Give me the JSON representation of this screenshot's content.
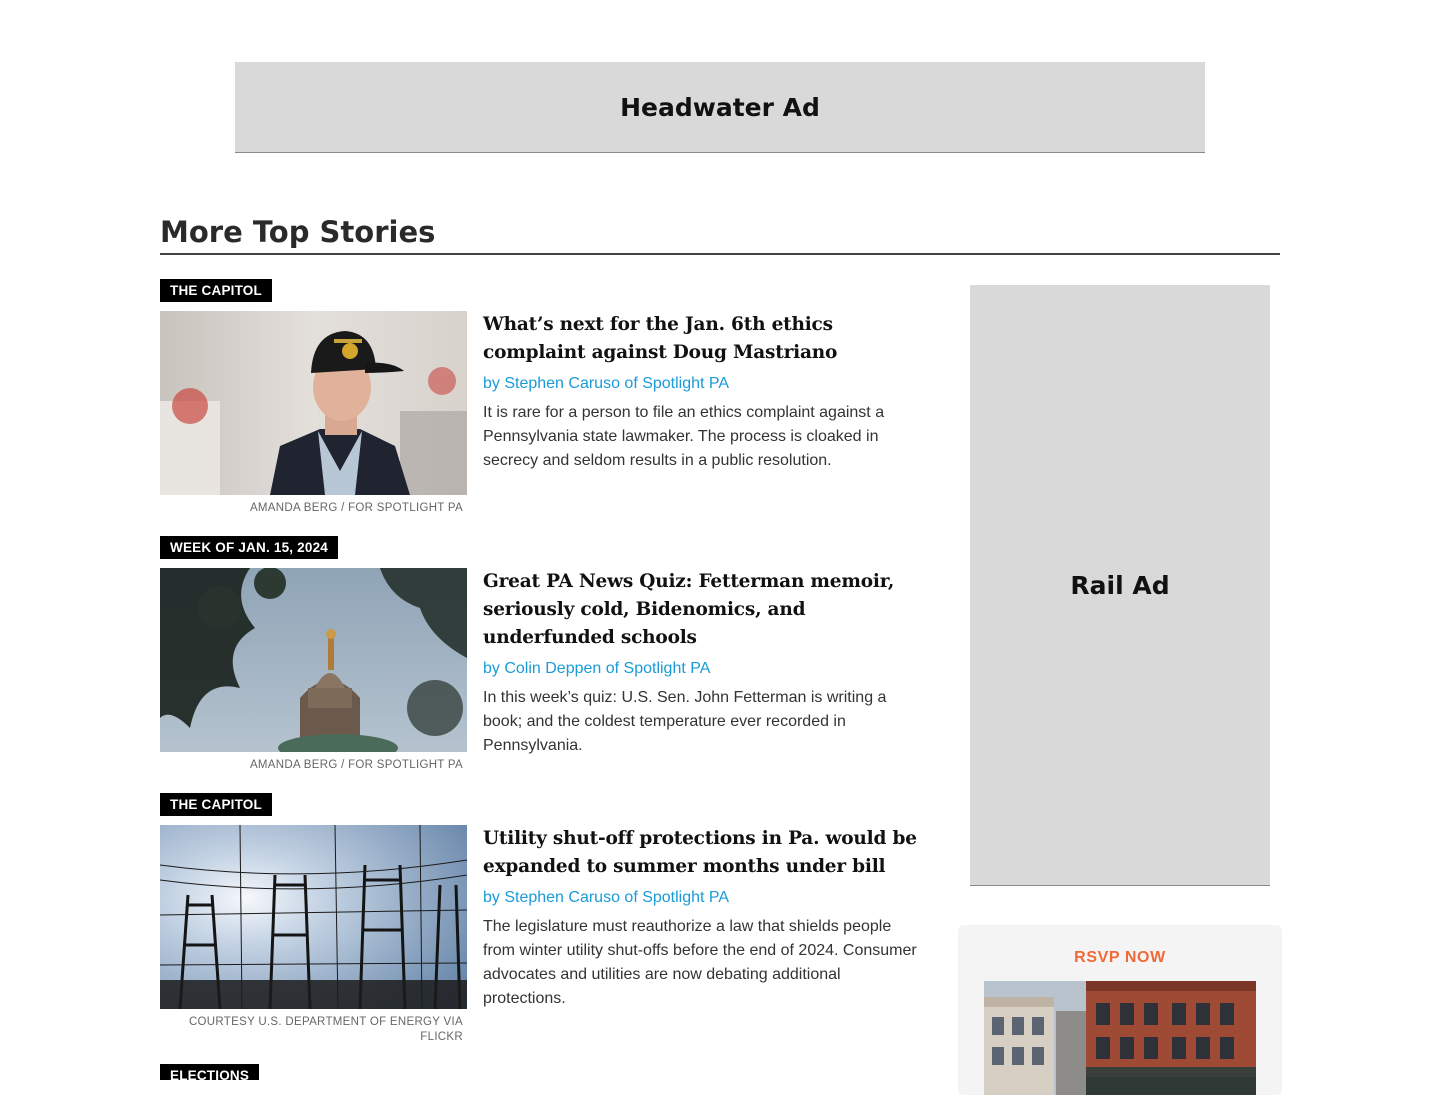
{
  "ads": {
    "headwater_label": "Headwater Ad",
    "rail_label": "Rail Ad"
  },
  "section": {
    "title": "More Top Stories"
  },
  "stories": [
    {
      "kicker": "THE CAPITOL",
      "headline": "What’s next for the Jan. 6th ethics complaint against Doug Mastriano",
      "byline": "by Stephen Caruso of Spotlight PA",
      "dek": "It is rare for a person to file an ethics complaint against a Pennsylvania state lawmaker. The process is cloaked in secrecy and seldom results in a public resolution.",
      "credit": "AMANDA BERG / FOR SPOTLIGHT PA",
      "image": "man-in-veteran-cap-photo"
    },
    {
      "kicker": "WEEK OF JAN. 15, 2024",
      "headline": "Great PA News Quiz: Fetterman memoir, seriously cold, Bidenomics, and underfunded schools",
      "byline": "by Colin Deppen of Spotlight PA",
      "dek": "In this week’s quiz: U.S. Sen. John Fetterman is writing a book; and the coldest temperature ever recorded in Pennsylvania.",
      "credit": "AMANDA BERG / FOR SPOTLIGHT PA",
      "image": "capitol-dome-photo"
    },
    {
      "kicker": "THE CAPITOL",
      "headline": "Utility shut-off protections in Pa. would be expanded to summer months under bill",
      "byline": "by Stephen Caruso of Spotlight PA",
      "dek": "The legislature must reauthorize a law that shields people from winter utility shut-offs before the end of 2024. Consumer advocates and utilities are now debating additional protections.",
      "credit": "COURTESY U.S. DEPARTMENT OF ENERGY VIA FLICKR",
      "image": "power-substation-photo"
    },
    {
      "kicker": "ELECTIONS"
    }
  ],
  "promo": {
    "cta": "RSVP NOW",
    "image": "main-street-storefronts-photo"
  },
  "colors": {
    "byline": "#1a9bd7",
    "rsvp": "#ee6a3a",
    "ad_background": "#d9d9d9",
    "kicker_background": "#000000"
  }
}
